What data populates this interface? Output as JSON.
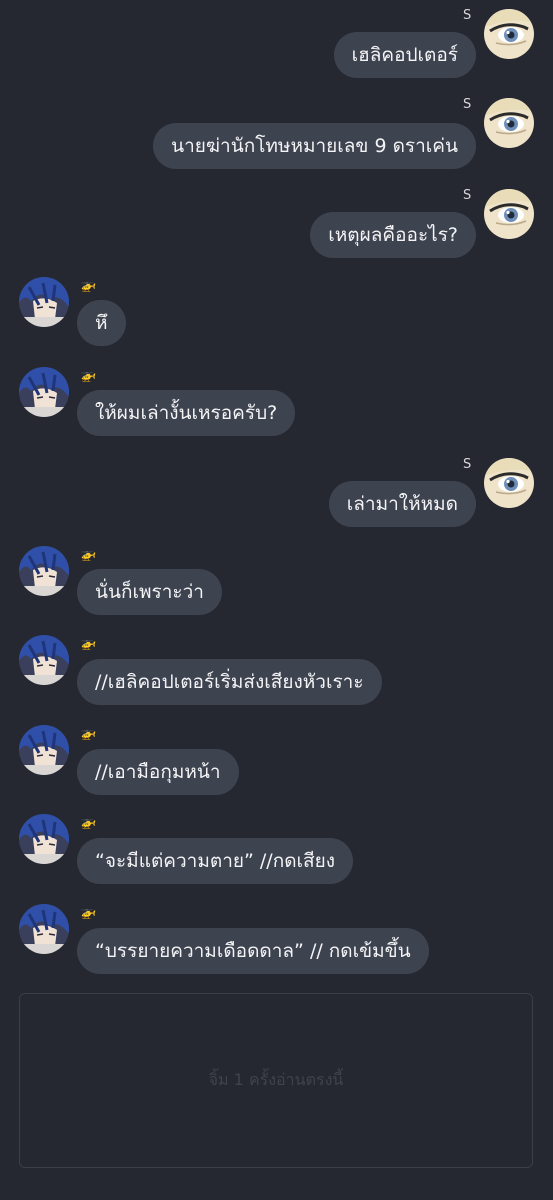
{
  "messages": [
    {
      "side": "right",
      "sender": "S",
      "text": "เฮลิคอปเตอร์",
      "avatar": "blonde-eye-avatar"
    },
    {
      "side": "right",
      "sender": "S",
      "text": "นายฆ่านักโทษหมายเลข 9 ดราเค่น",
      "avatar": "blonde-eye-avatar"
    },
    {
      "side": "right",
      "sender": "S",
      "text": "เหตุผลคืออะไร?",
      "avatar": "blonde-eye-avatar"
    },
    {
      "side": "left",
      "sender": "🚁",
      "text": "หึ",
      "avatar": "blue-hair-avatar"
    },
    {
      "side": "left",
      "sender": "🚁",
      "text": "ให้ผมเล่างั้นเหรอครับ?",
      "avatar": "blue-hair-avatar"
    },
    {
      "side": "right",
      "sender": "S",
      "text": "เล่ามาให้หมด",
      "avatar": "blonde-eye-avatar"
    },
    {
      "side": "left",
      "sender": "🚁",
      "text": "นั่นก็เพราะว่า",
      "avatar": "blue-hair-avatar"
    },
    {
      "side": "left",
      "sender": "🚁",
      "text": "//เฮลิคอปเตอร์เริ่มส่งเสียงหัวเราะ",
      "avatar": "blue-hair-avatar"
    },
    {
      "side": "left",
      "sender": "🚁",
      "text": "//เอามือกุมหน้า",
      "avatar": "blue-hair-avatar"
    },
    {
      "side": "left",
      "sender": "🚁",
      "text": "“จะมีแต่ความตาย” //กดเสียง",
      "avatar": "blue-hair-avatar"
    },
    {
      "side": "left",
      "sender": "🚁",
      "text": "“บรรยายความเดือดดาล” // กดเข้มขึ้น",
      "avatar": "blue-hair-avatar"
    }
  ],
  "composer": {
    "placeholder": "จิ้ม 1 ครั้งอ่านตรงนี้"
  },
  "colors": {
    "background": "#252830",
    "bubble": "#3e4350",
    "text": "#f4f4f6"
  }
}
